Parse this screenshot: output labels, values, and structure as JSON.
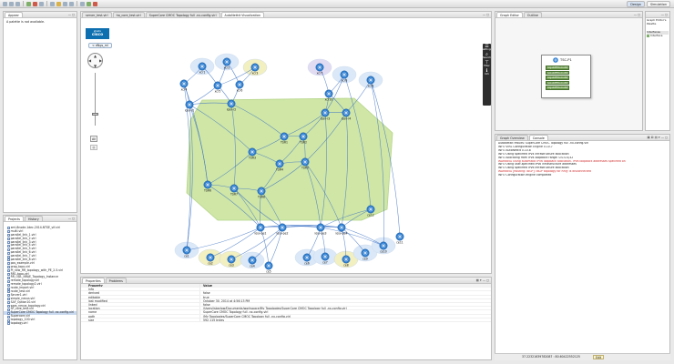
{
  "toolbar": {
    "perspectives": [
      "Design",
      "Simulation"
    ]
  },
  "appearance": {
    "tab": "Appear",
    "message": "A palette is not available."
  },
  "projects": {
    "tabs": [
      "Projects",
      "History"
    ],
    "files": [
      "xml-8node-1dec-2014-NTSE_vif.virl",
      "multi.virl",
      "parallel_link_1.virl",
      "parallel_link_2.virl",
      "parallel_link_3.virl",
      "parallel_link_4.virl",
      "parallel_link_5.virl",
      "parallel_link_6.virl",
      "parallel_link_7.virl",
      "parallel_link_8.virl",
      "pos_example.virl",
      "prog_topo.virl",
      "PI_new_RR_topology_with_PE_2-5.virl",
      "RR1-topo.virl",
      "RR_ODL_NRAE_Topology_Instance",
      "remote_topology.virl",
      "remote_topology2.virl",
      "route_import.virl",
      "route_test.virl",
      "Server1.virl",
      "simple_nexus.virl",
      "SAF_Option10.virl",
      "saas_nexus_topology.virl",
      "SP_core_test.virl",
      "SuperCore CMOC Topology full -nx-config.virl",
      "Supercore.virl",
      "topology_100.virl",
      "topology.virl"
    ],
    "selected_index": 24
  },
  "editor": {
    "tabs": [
      "server_test.virl",
      "ha_core_test.virl",
      "SuperCore CMOC Topology full -nx-config.virl",
      "AutoNetkit Visualization"
    ],
    "active_tab": 3,
    "brand": "cisco",
    "breadcrumb": "< dNgs_ml",
    "fit_label": "All",
    "palette": [
      {
        "icon": "select-icon",
        "glyph": "☰",
        "label": "Settings"
      },
      {
        "icon": "search-icon",
        "glyph": "⌕",
        "label": "Search"
      },
      {
        "icon": "filter-icon",
        "glyph": "⊤",
        "label": "Filter"
      },
      {
        "icon": "info-icon",
        "glyph": "ℹ",
        "label": "Info"
      }
    ]
  },
  "topology": {
    "nodes": [
      {
        "id": "n1",
        "label": "xcr1"
      },
      {
        "id": "n2",
        "label": "xcr2"
      },
      {
        "id": "n3",
        "label": "xcr3"
      },
      {
        "id": "n4",
        "label": "xcr4"
      },
      {
        "id": "n5",
        "label": "xcr5"
      },
      {
        "id": "n6",
        "label": "xcr6"
      },
      {
        "id": "n7",
        "label": "iosv-r1"
      },
      {
        "id": "n8",
        "label": "iosv-r2"
      },
      {
        "id": "n9",
        "label": "xcr7"
      },
      {
        "id": "n10",
        "label": "xcr8"
      },
      {
        "id": "n11",
        "label": "xcr9"
      },
      {
        "id": "n12",
        "label": "xcr10"
      },
      {
        "id": "n13",
        "label": "iosv-r3"
      },
      {
        "id": "n14",
        "label": "iosv-r4"
      },
      {
        "id": "n15",
        "label": "TSR1"
      },
      {
        "id": "n16",
        "label": "TSR2"
      },
      {
        "id": "n17",
        "label": "TSR3"
      },
      {
        "id": "n18",
        "label": "TSR4"
      },
      {
        "id": "n19",
        "label": "TSR5"
      },
      {
        "id": "n20",
        "label": "TSR6"
      },
      {
        "id": "n21",
        "label": "TSR7"
      },
      {
        "id": "n22",
        "label": "TSR8"
      },
      {
        "id": "n23",
        "label": "iosv-pe1"
      },
      {
        "id": "n24",
        "label": "iosv-pe2"
      },
      {
        "id": "n25",
        "label": "iosv-pe3"
      },
      {
        "id": "n26",
        "label": "iosv-pe4"
      },
      {
        "id": "n27",
        "label": "ce1"
      },
      {
        "id": "n28",
        "label": "ce2"
      },
      {
        "id": "n29",
        "label": "ce3"
      },
      {
        "id": "n30",
        "label": "ce4"
      },
      {
        "id": "n31",
        "label": "ce5"
      },
      {
        "id": "n32",
        "label": "ce6"
      },
      {
        "id": "n33",
        "label": "ce7"
      },
      {
        "id": "n34",
        "label": "ce8"
      },
      {
        "id": "n35",
        "label": "ce9"
      },
      {
        "id": "n36",
        "label": "ce10"
      },
      {
        "id": "n37",
        "label": "ce11"
      },
      {
        "id": "n38",
        "label": "ce12"
      }
    ],
    "colors": {
      "core_area": "#cfe6a6",
      "halo_blue": "#dbe8f7",
      "halo_yellow": "#f2efc0",
      "halo_purple": "#e2dcf3",
      "router": "#2f7fd1",
      "link": "#3a6fc4"
    }
  },
  "properties": {
    "tabs": [
      "Properties",
      "Problems"
    ],
    "columns": [
      "Property",
      "Value"
    ],
    "rows": [
      {
        "k": "Info",
        "v": ""
      },
      {
        "k": "derived",
        "v": "false"
      },
      {
        "k": "editable",
        "v": "true"
      },
      {
        "k": "last modified",
        "v": "October 30, 2014 at 4:56:13 PM"
      },
      {
        "k": "linked",
        "v": "false"
      },
      {
        "k": "location",
        "v": "/Users/jsbarlow/Documents/workspace/My Topologies/SuperCore CMOC Topology full -nx-config.virl"
      },
      {
        "k": "name",
        "v": "SuperCore CMOC Topology full -nx-config.virl"
      },
      {
        "k": "path",
        "v": "/My Topologies/SuperCore CMOC Topology full -nx-config.virl"
      },
      {
        "k": "size",
        "v": "592,115  bytes"
      }
    ]
  },
  "graph_editor": {
    "tabs": [
      "Graph Editor",
      "Outline"
    ],
    "node_title": "TSC-P1",
    "ports": [
      "GigabitEthernet0/1",
      "GigabitEthernet0/2",
      "GigabitEthernet0/3",
      "GigabitEthernet0/4",
      "GigabitEthernet0/5"
    ]
  },
  "outline": {
    "items": [
      "Graph Editor's Palette",
      "Interfaces",
      "Interface"
    ]
  },
  "console": {
    "tabs": [
      "Graph Overview",
      "Console"
    ],
    "lines": [
      {
        "t": "AutoNetkit results: SuperCore CMOC Topology full -nx-config.virl",
        "err": false
      },
      {
        "t": "INFO VIRL Configuration Engine 0.10.7",
        "err": false
      },
      {
        "t": "INFO AutoNetkit 0.10.8",
        "err": false
      },
      {
        "t": "INFO Using specified IPv4 infrastructure allocation",
        "err": false
      },
      {
        "t": "INFO Allocating from IPv4 loopback range: 0.0.0.0/32",
        "err": false
      },
      {
        "t": "WARNING Using automatic IPv6 loopback allocation. IPv6 loopback addresses specified on",
        "err": true
      },
      {
        "t": "INFO Using user-specified IPv6 infrastructure addresses",
        "err": false
      },
      {
        "t": "INFO Using specified IPv6 infrastructure allocation",
        "err": false
      },
      {
        "t": "WARNING [Routing: iBGP]: iBGP topology for RR@ is disconnected",
        "err": true
      },
      {
        "t": "INFO Configuration engine completed",
        "err": false
      }
    ]
  },
  "status": {
    "coords": "37.22321639782087 : 80.60422552125",
    "mode": "Edit"
  }
}
